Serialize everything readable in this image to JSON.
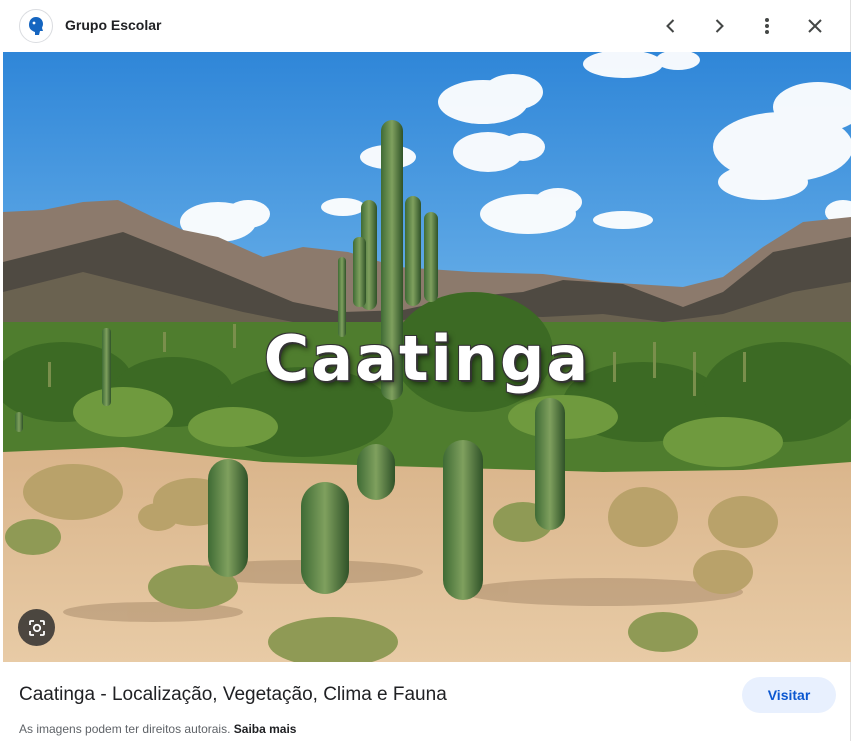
{
  "header": {
    "source_name": "Grupo Escolar",
    "source_logo_icon": "blue-head-logo-icon",
    "buttons": [
      {
        "name": "previous-button",
        "icon": "chevron-left-icon"
      },
      {
        "name": "next-button",
        "icon": "chevron-right-icon"
      },
      {
        "name": "more-options-button",
        "icon": "more-vert-icon"
      },
      {
        "name": "close-button",
        "icon": "close-icon"
      }
    ]
  },
  "image": {
    "overlay_text": "Caatinga",
    "lens_icon": "google-lens-icon"
  },
  "footer": {
    "title": "Caatinga - Localização, Vegetação, Clima e Fauna",
    "visit_label": "Visitar",
    "copyright_notice": "As imagens podem ter direitos autorais.",
    "learn_more_label": "Saiba mais"
  },
  "colors": {
    "accent": "#0b57d0",
    "visit_bg": "#e8f0fe",
    "text": "#202124",
    "muted": "#5f6368",
    "sky": "#3a8fd9"
  }
}
